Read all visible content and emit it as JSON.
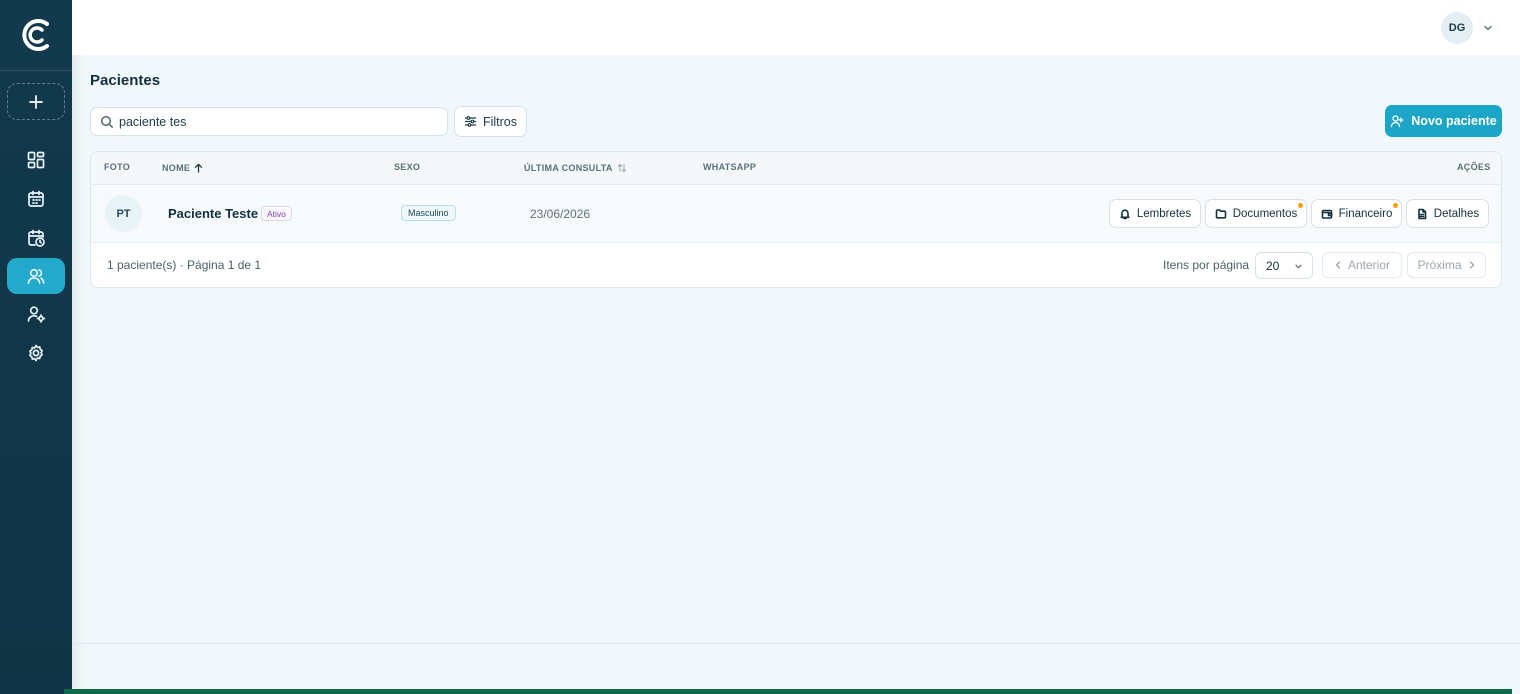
{
  "user": {
    "initials": "DG"
  },
  "sidebar": {
    "items": [
      {
        "icon": "grid-icon"
      },
      {
        "icon": "calendar-icon"
      },
      {
        "icon": "calendar-clock-icon"
      },
      {
        "icon": "users-icon",
        "active": true
      },
      {
        "icon": "user-cog-icon"
      },
      {
        "icon": "gear-icon"
      }
    ]
  },
  "page": {
    "title": "Pacientes"
  },
  "search": {
    "value": "paciente tes"
  },
  "toolbar": {
    "filters_label": "Filtros",
    "new_patient_label": "Novo paciente"
  },
  "table": {
    "columns": {
      "photo": "FOTO",
      "name": "NOME",
      "sex": "SEXO",
      "last_visit": "ÚLTIMA CONSULTA",
      "whatsapp": "WHATSAPP",
      "actions": "AÇÕES"
    },
    "rows": [
      {
        "initials": "PT",
        "name": "Paciente Teste",
        "status": "Ativo",
        "sex": "Masculino",
        "last_visit": "23/06/2026",
        "whatsapp": "",
        "actions": {
          "reminders": "Lembretes",
          "documents": "Documentos",
          "finance": "Financeiro",
          "details": "Detalhes"
        }
      }
    ]
  },
  "pagination": {
    "summary": "1 paciente(s) · Página 1 de 1",
    "per_page_label": "Itens por página",
    "per_page_value": "20",
    "prev_label": "Anterior",
    "next_label": "Próxima"
  },
  "colors": {
    "accent": "#1ba6c7",
    "sidebar": "#123a4c",
    "notification": "#f59e0b"
  }
}
